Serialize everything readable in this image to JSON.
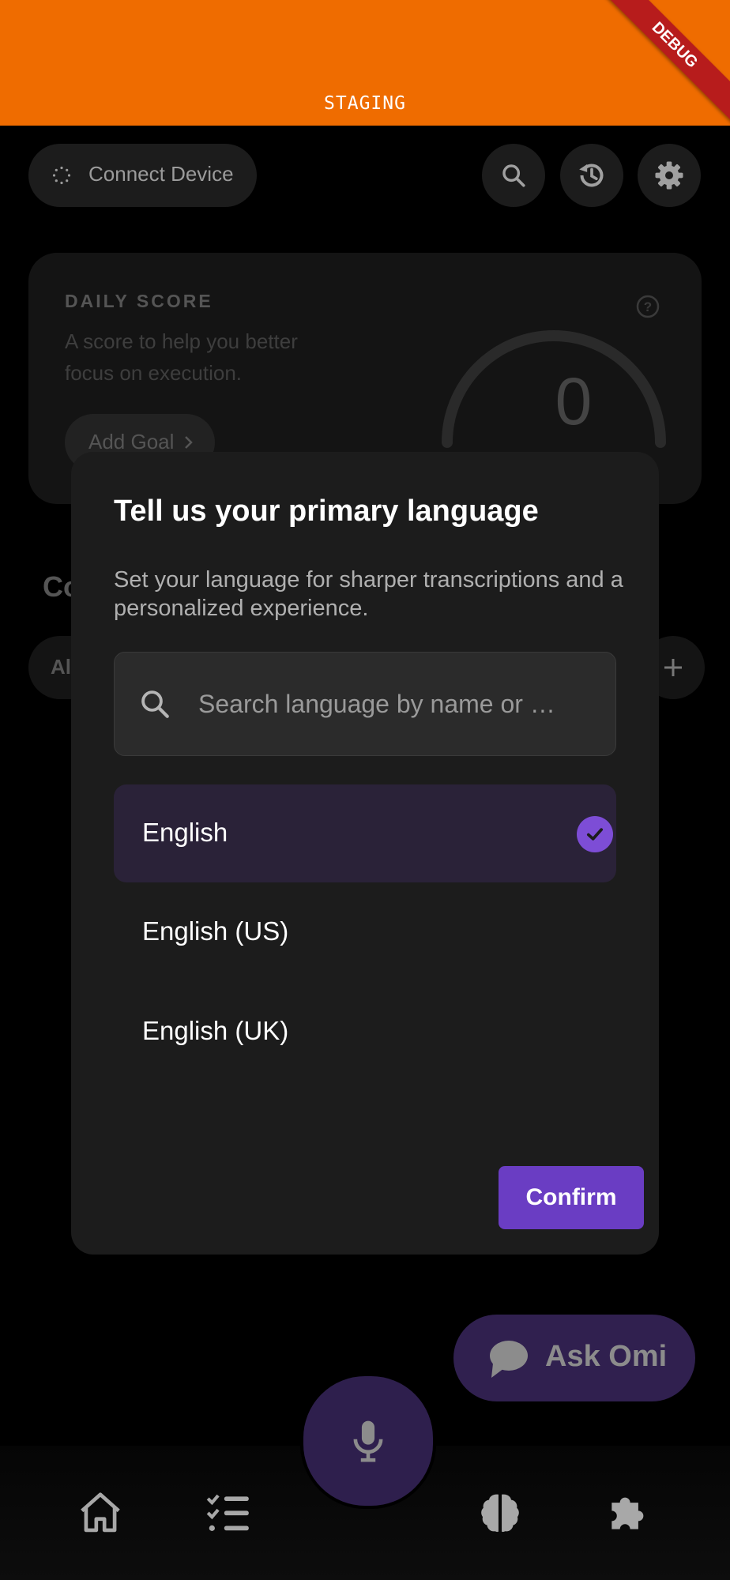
{
  "banner": {
    "label": "STAGING",
    "ribbon": "DEBUG",
    "color": "#EF6C00"
  },
  "header": {
    "connect_label": "Connect Device",
    "icons": [
      "search-icon",
      "history-icon",
      "gear-icon"
    ]
  },
  "score_card": {
    "title": "DAILY SCORE",
    "description": "A score to help you better focus on execution.",
    "add_goal_label": "Add Goal",
    "score": "0"
  },
  "background": {
    "section_partial": "Co",
    "filter_partial": "Al"
  },
  "dialog": {
    "title": "Tell us your primary language",
    "subtitle": "Set your language for sharper transcriptions and a personalized experience.",
    "search_placeholder": "Search language by name or …",
    "languages": [
      {
        "label": "English",
        "selected": true
      },
      {
        "label": "English (US)",
        "selected": false
      },
      {
        "label": "English (UK)",
        "selected": false
      }
    ],
    "confirm_label": "Confirm"
  },
  "ask_omi": {
    "label": "Ask Omi"
  },
  "nav": {
    "items": [
      "home-icon",
      "tasks-icon",
      "mic-icon",
      "brain-icon",
      "puzzle-icon"
    ]
  },
  "colors": {
    "accent": "#6A3DC3",
    "dialog_bg": "#1c1c1c",
    "selected_bg": "#2a2238"
  }
}
